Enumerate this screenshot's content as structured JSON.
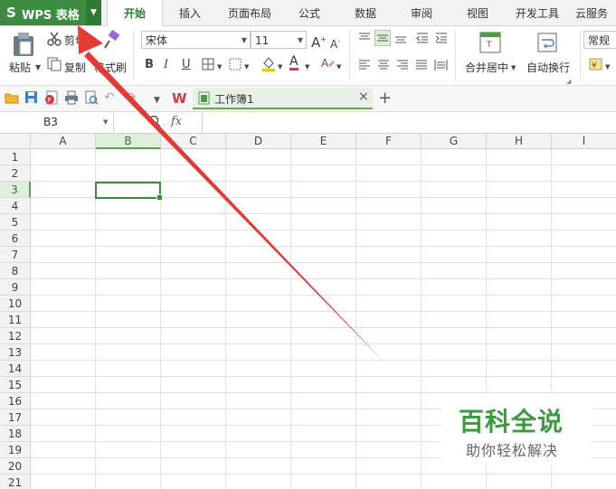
{
  "app": {
    "logo": "S",
    "name": "WPS 表格",
    "dropdown": "▼"
  },
  "menu": [
    {
      "label": "开始",
      "active": true
    },
    {
      "label": "插入"
    },
    {
      "label": "页面布局"
    },
    {
      "label": "公式"
    },
    {
      "label": "数据"
    },
    {
      "label": "审阅"
    },
    {
      "label": "视图"
    },
    {
      "label": "开发工具"
    },
    {
      "label": "云服务"
    }
  ],
  "ribbon": {
    "paste": "粘贴",
    "cut": "剪切",
    "copy": "复制",
    "format_painter": "格式刷",
    "font_name": "宋体",
    "font_size": "11",
    "grow_font": "A",
    "shrink_font": "A",
    "bold": "B",
    "italic": "I",
    "underline": "U",
    "font_color_letter": "A",
    "merge_center": "合并居中",
    "wrap_text": "自动换行",
    "number_format": "常规"
  },
  "document": {
    "tab_title": "工作簿1",
    "close": "×",
    "new_tab": "+"
  },
  "formula": {
    "name_box": "B3",
    "fx": "fx",
    "value": ""
  },
  "grid": {
    "columns": [
      "A",
      "B",
      "C",
      "D",
      "E",
      "F",
      "G",
      "H",
      "I"
    ],
    "rows": [
      "1",
      "2",
      "3",
      "4",
      "5",
      "6",
      "7",
      "8",
      "9",
      "10",
      "11",
      "12",
      "13",
      "14",
      "15",
      "16",
      "17",
      "18",
      "19",
      "20",
      "21"
    ],
    "selected_column": "B",
    "selected_row": "3"
  },
  "watermark": {
    "title": "百科全说",
    "subtitle": "助你轻松解决"
  },
  "colors": {
    "accent_green": "#3d8b40",
    "arrow_red": "#e53935"
  }
}
